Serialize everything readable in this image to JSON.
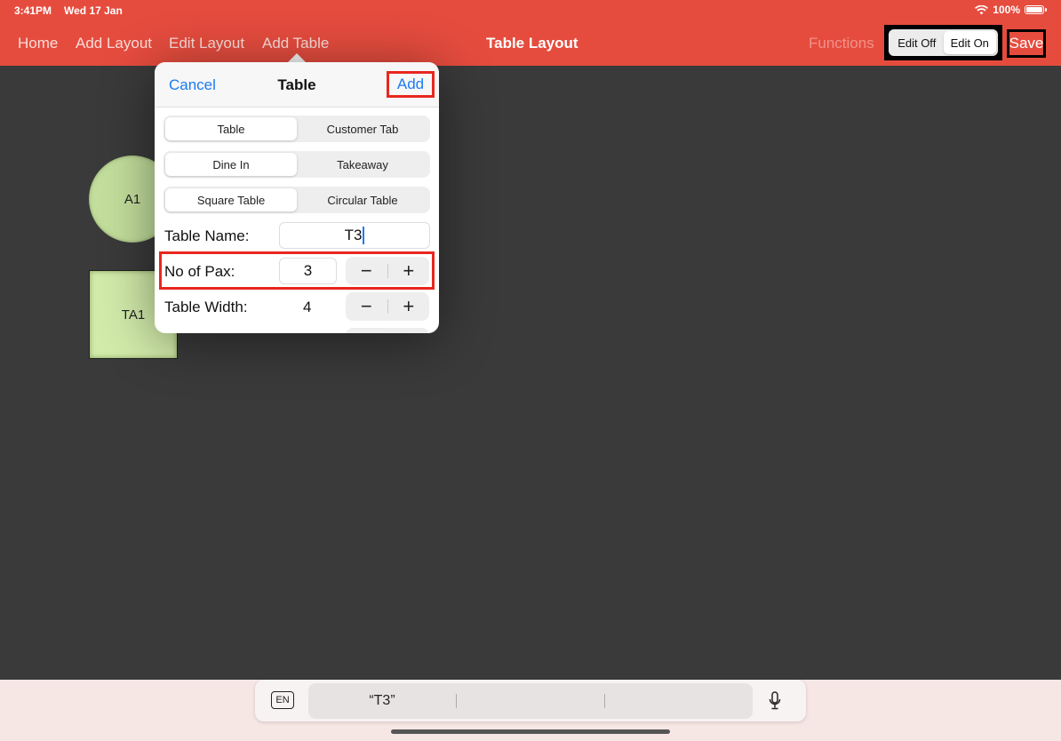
{
  "status_bar": {
    "time": "3:41PM",
    "date": "Wed 17 Jan",
    "battery": "100%",
    "wifi_icon": "wifi-icon",
    "battery_icon": "battery-icon"
  },
  "nav": {
    "items": [
      "Home",
      "Add Layout",
      "Edit Layout",
      "Add Table"
    ],
    "title": "Table Layout",
    "functions": "Functions",
    "edit_toggle": {
      "off": "Edit Off",
      "on": "Edit On",
      "selected": "Edit On"
    },
    "save": "Save"
  },
  "canvas": {
    "tables": [
      {
        "label": "A1",
        "shape": "circle"
      },
      {
        "label": "TA1",
        "shape": "square"
      }
    ]
  },
  "popover": {
    "title": "Table",
    "cancel": "Cancel",
    "add": "Add",
    "seg_type": {
      "options": [
        "Table",
        "Customer Tab"
      ],
      "selected": "Table"
    },
    "seg_service": {
      "options": [
        "Dine In",
        "Takeaway"
      ],
      "selected": "Dine In"
    },
    "seg_shape": {
      "options": [
        "Square Table",
        "Circular Table"
      ],
      "selected": "Square Table"
    },
    "table_name_label": "Table Name:",
    "table_name_value": "T3",
    "pax_label": "No of Pax:",
    "pax_value": "3",
    "width_label": "Table Width:",
    "width_value": "4",
    "minus": "−",
    "plus": "+"
  },
  "keyboard_bar": {
    "lang": "EN",
    "suggestions": [
      "“T3”",
      "",
      ""
    ],
    "mic_icon": "microphone-icon"
  },
  "colors": {
    "header": "#e54c3e",
    "accent_blue": "#1a7bf2",
    "highlight_red": "#e8271e",
    "canvas_bg": "#3a3a3a",
    "table_green": "#c4df9d"
  }
}
